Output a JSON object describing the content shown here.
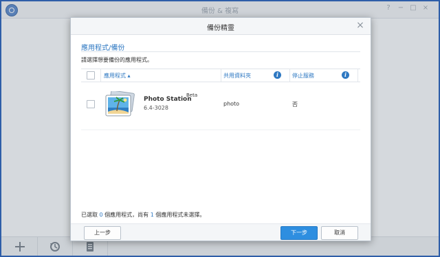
{
  "window": {
    "title": "備份 & 複寫",
    "controls": {
      "help": "?",
      "minimize": "−",
      "maximize": "□",
      "close": "×"
    }
  },
  "bottombar": {
    "items": [
      {
        "name": "add-icon"
      },
      {
        "name": "history-icon"
      },
      {
        "name": "log-icon"
      }
    ]
  },
  "modal": {
    "title": "備份精靈",
    "close": "×",
    "section_title": "應用程式/備份",
    "description": "請選擇想要備份的應用程式。",
    "columns": {
      "app": "應用程式 ▴",
      "folder": "共用資料夾",
      "stop": "停止服務"
    },
    "rows": [
      {
        "name": "Photo Station",
        "badge": "Beta",
        "version": "6.4-3028",
        "folder": "photo",
        "stop": "否"
      }
    ],
    "summary": {
      "part1": "已選取 ",
      "selected": "0",
      "part2": " 個應用程式，尚有 ",
      "unselected": "1",
      "part3": " 個應用程式未選擇。"
    },
    "buttons": {
      "back": "上一步",
      "next": "下一步",
      "cancel": "取消"
    }
  },
  "colors": {
    "accent": "#2e78c2",
    "primary_button": "#2e8ee0",
    "frame": "#2e5ea8"
  }
}
